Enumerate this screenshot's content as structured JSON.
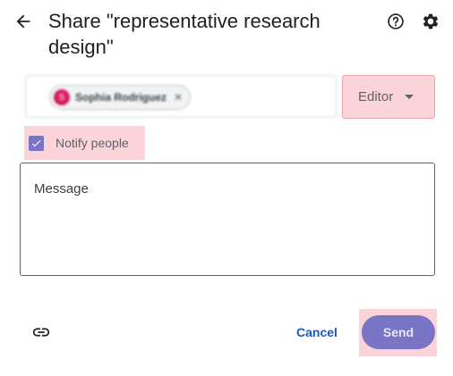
{
  "header": {
    "title": "Share \"representative research design\"",
    "back_icon": "arrow-back-icon",
    "help_icon": "help-circle-icon",
    "settings_icon": "gear-icon"
  },
  "people": {
    "chips": [
      {
        "initial": "S",
        "name": "Sophia Rodriguez",
        "remove_glyph": "✕"
      }
    ]
  },
  "role": {
    "selected": "Editor"
  },
  "notify": {
    "label": "Notify people",
    "checked": true
  },
  "message": {
    "placeholder": "Message",
    "value": ""
  },
  "footer": {
    "copy_link_icon": "link-icon",
    "cancel_label": "Cancel",
    "send_label": "Send"
  },
  "colors": {
    "accent": "#7a74c4",
    "highlight": "#fad4d8",
    "link_blue": "#1a56c8"
  }
}
